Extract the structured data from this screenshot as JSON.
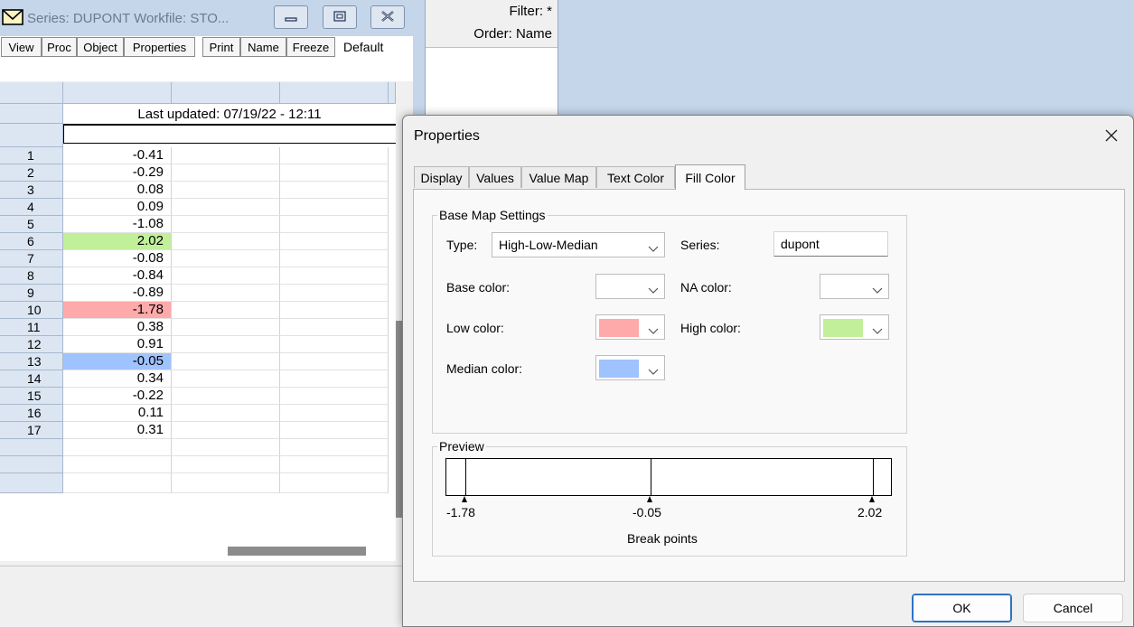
{
  "series_window": {
    "title": "Series: DUPONT   Workfile: STO...",
    "toolbar": {
      "buttons": [
        "View",
        "Proc",
        "Object",
        "Properties",
        "Print",
        "Name",
        "Freeze"
      ],
      "default_label": "Default"
    },
    "last_updated": "Last updated: 07/19/22 - 12:11",
    "rows": [
      {
        "n": "1",
        "v": "-0.41"
      },
      {
        "n": "2",
        "v": "-0.29"
      },
      {
        "n": "3",
        "v": "0.08"
      },
      {
        "n": "4",
        "v": "0.09"
      },
      {
        "n": "5",
        "v": "-1.08"
      },
      {
        "n": "6",
        "v": "2.02",
        "fill": "#c2ef9a"
      },
      {
        "n": "7",
        "v": "-0.08"
      },
      {
        "n": "8",
        "v": "-0.84"
      },
      {
        "n": "9",
        "v": "-0.89"
      },
      {
        "n": "10",
        "v": "-1.78",
        "fill": "#ffaaaa"
      },
      {
        "n": "11",
        "v": "0.38"
      },
      {
        "n": "12",
        "v": "0.91"
      },
      {
        "n": "13",
        "v": "-0.05",
        "fill": "#9fc3ff"
      },
      {
        "n": "14",
        "v": "0.34"
      },
      {
        "n": "15",
        "v": "-0.22"
      },
      {
        "n": "16",
        "v": "0.11"
      },
      {
        "n": "17",
        "v": "0.31"
      }
    ]
  },
  "workfile_panel": {
    "filter": "Filter: *",
    "order": "Order: Name"
  },
  "dialog": {
    "title": "Properties",
    "tabs": [
      {
        "label": "Display",
        "active": false
      },
      {
        "label": "Values",
        "active": false
      },
      {
        "label": "Value Map",
        "active": false
      },
      {
        "label": "Text Color",
        "active": false
      },
      {
        "label": "Fill Color",
        "active": true
      }
    ],
    "base_map": {
      "legend": "Base Map Settings",
      "type_label": "Type:",
      "type_value": "High-Low-Median",
      "series_label": "Series:",
      "series_value": "dupont",
      "base_color_label": "Base color:",
      "base_color": "#ffffff",
      "na_color_label": "NA color:",
      "na_color": "#ffffff",
      "low_color_label": "Low color:",
      "low_color": "#ffaaaa",
      "high_color_label": "High color:",
      "high_color": "#c2ef9a",
      "median_color_label": "Median color:",
      "median_color": "#9fc3ff"
    },
    "preview": {
      "legend": "Preview",
      "min": -1.78,
      "max": 2.02,
      "break_points": [
        {
          "value": -1.78,
          "label": "-1.78"
        },
        {
          "value": -0.05,
          "label": "-0.05"
        },
        {
          "value": 2.02,
          "label": "2.02"
        }
      ],
      "caption": "Break points"
    },
    "ok_label": "OK",
    "cancel_label": "Cancel"
  }
}
